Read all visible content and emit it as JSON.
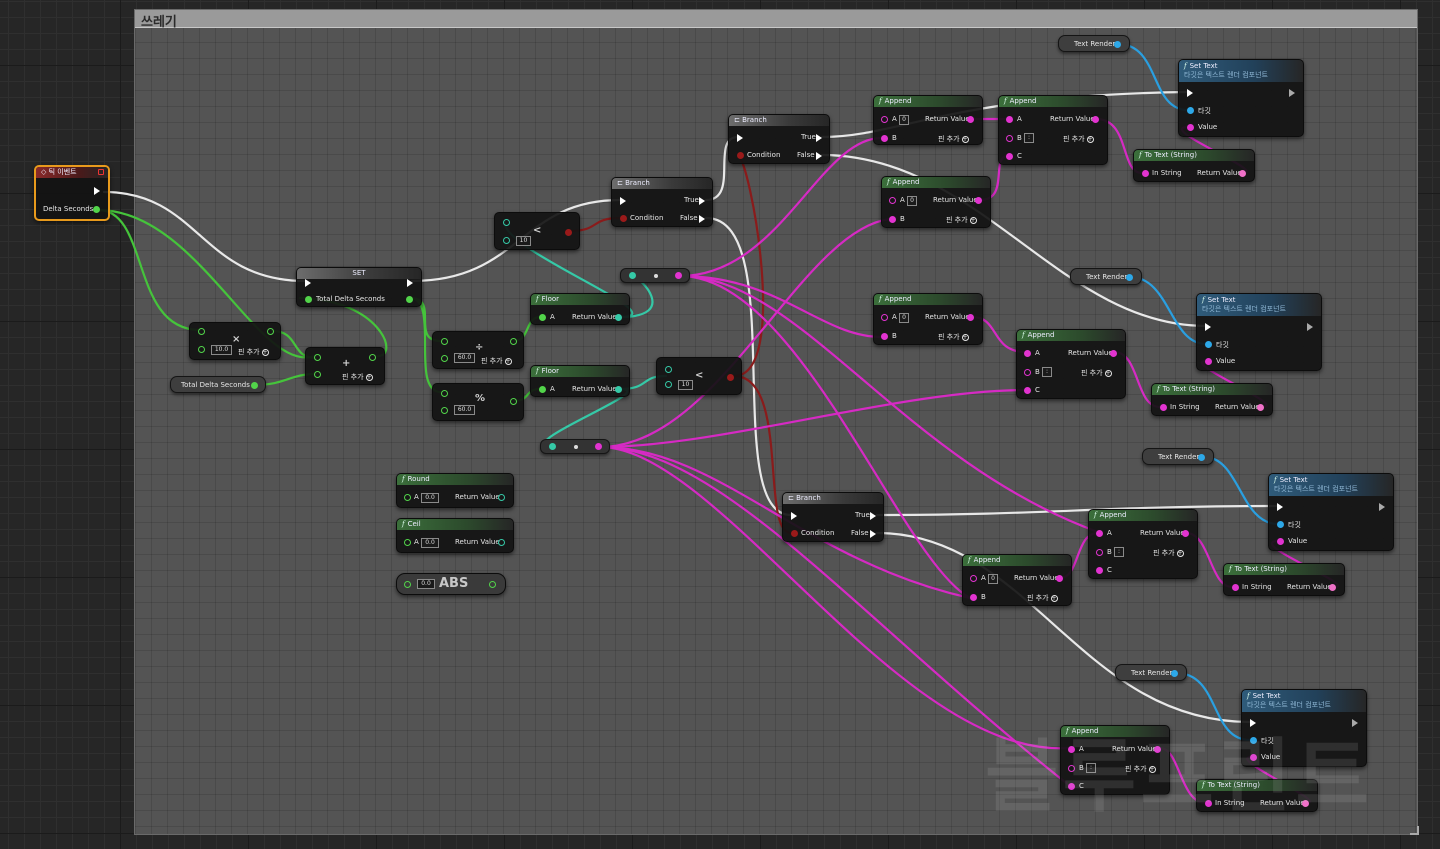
{
  "comment": {
    "title": "쓰레기"
  },
  "event_tick": {
    "title": "틱 이벤트",
    "delta_pin": "Delta Seconds"
  },
  "set_node": {
    "title": "SET",
    "var_pin": "Total Delta Seconds"
  },
  "var_total_delta": {
    "label": "Total Delta Seconds"
  },
  "multiply_node": {
    "op": "×",
    "value": "10.0",
    "add_pin": "핀 추가"
  },
  "add_node": {
    "op": "+",
    "add_pin": "핀 추가"
  },
  "less1_node": {
    "op": "<",
    "value": "10"
  },
  "divide_node": {
    "op": "÷",
    "value": "60.0",
    "add_pin": "핀 추가"
  },
  "modulo_node": {
    "op": "%",
    "value": "60.0"
  },
  "floor1": {
    "title": "Floor",
    "a": "A",
    "ret": "Return Value"
  },
  "floor2": {
    "title": "Floor",
    "a": "A",
    "ret": "Return Value"
  },
  "less2_node": {
    "op": "<",
    "value": "10"
  },
  "round_node": {
    "title": "Round",
    "a": "A",
    "value": "0.0",
    "ret": "Return Value"
  },
  "ceil_node": {
    "title": "Ceil",
    "a": "A",
    "value": "0.0",
    "ret": "Return Value"
  },
  "abs_node": {
    "title": "ABS",
    "value": "0.0"
  },
  "branch1": {
    "title": "Branch",
    "cond": "Condition",
    "true": "True",
    "false": "False"
  },
  "branch2": {
    "title": "Branch",
    "cond": "Condition",
    "true": "True",
    "false": "False"
  },
  "branch3": {
    "title": "Branch",
    "cond": "Condition",
    "true": "True",
    "false": "False"
  },
  "append_common": {
    "a": "A",
    "b": "B",
    "c": "C",
    "ret": "Return Value",
    "add_pin": "핀 추가",
    "title": "Append"
  },
  "append_values": {
    "zero": "0",
    "colon": ":"
  },
  "settext_common": {
    "title": "Set Text",
    "subtitle": "타깃은 텍스트 렌더 컴포넌트",
    "target": "타깃",
    "value": "Value"
  },
  "totext_common": {
    "title": "To Text (String)",
    "in": "In String",
    "ret": "Return Value"
  },
  "textrender": {
    "label": "Text Render"
  },
  "watermark": "블루프린트"
}
